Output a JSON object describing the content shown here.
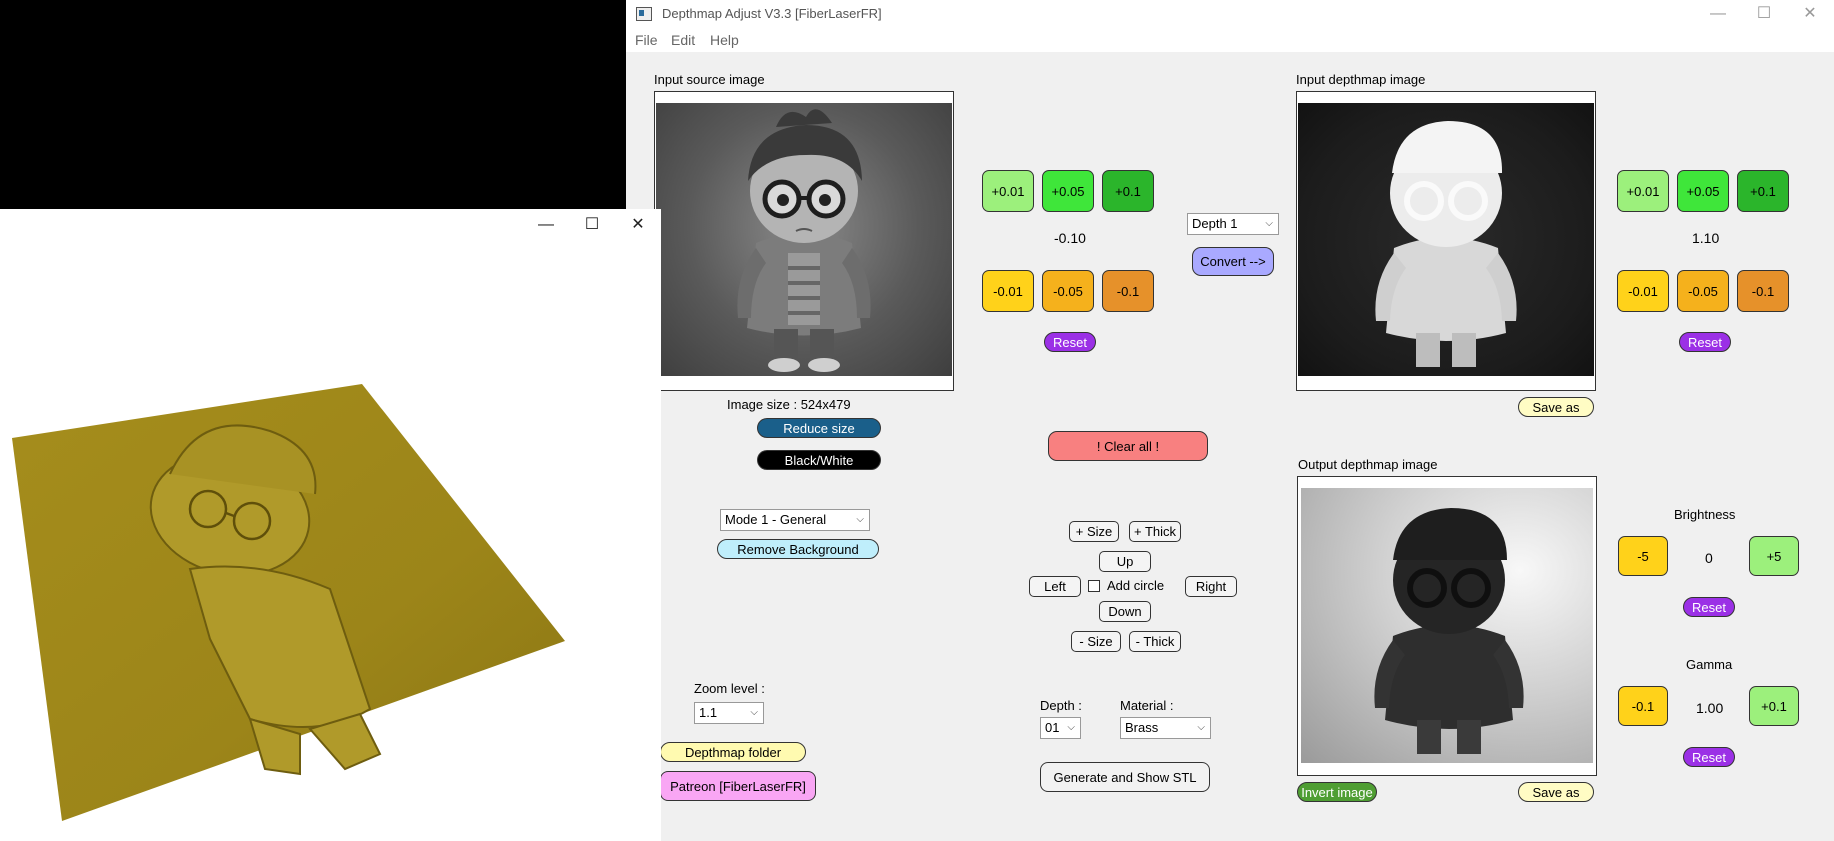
{
  "window": {
    "title": "Depthmap Adjust V3.3 [FiberLaserFR]",
    "minimize_glyph": "—",
    "maximize_glyph": "☐",
    "close_glyph": "✕"
  },
  "menu": [
    "File",
    "Edit",
    "Help"
  ],
  "source": {
    "label": "Input source image",
    "size_text": "Image size : 524x479",
    "reduce_label": "Reduce size",
    "bw_label": "Black/White",
    "mode_value": "Mode 1 - General",
    "remove_bg_label": "Remove Background",
    "zoom_label": "Zoom level :",
    "zoom_value": "1.1",
    "folder_label": "Depthmap folder",
    "patreon_label": "Patreon [FiberLaserFR]"
  },
  "adjust_left": {
    "plus": [
      "+0.01",
      "+0.05",
      "+0.1"
    ],
    "value": "-0.10",
    "minus": [
      "-0.01",
      "-0.05",
      "-0.1"
    ],
    "reset_label": "Reset"
  },
  "convert": {
    "depth_value": "Depth 1",
    "convert_label": "Convert -->"
  },
  "clear_all_label": "!   Clear all   !",
  "circle": {
    "size_plus": "+ Size",
    "thick_plus": "+ Thick",
    "up": "Up",
    "left": "Left",
    "add_circle": "Add circle",
    "right": "Right",
    "down": "Down",
    "size_minus": "- Size",
    "thick_minus": "- Thick"
  },
  "stl": {
    "depth_label": "Depth :",
    "depth_value": "01",
    "material_label": "Material :",
    "material_value": "Brass",
    "generate_label": "Generate and Show STL"
  },
  "input_depth": {
    "label": "Input depthmap image",
    "plus": [
      "+0.01",
      "+0.05",
      "+0.1"
    ],
    "value": "1.10",
    "minus": [
      "-0.01",
      "-0.05",
      "-0.1"
    ],
    "reset_label": "Reset",
    "save_label": "Save as"
  },
  "output_depth": {
    "label": "Output depthmap image",
    "invert_label": "Invert image",
    "save_label": "Save as"
  },
  "brightness": {
    "label": "Brightness",
    "minus": "-5",
    "value": "0",
    "plus": "+5",
    "reset_label": "Reset"
  },
  "gamma": {
    "label": "Gamma",
    "minus": "-0.1",
    "value": "1.00",
    "plus": "+0.1",
    "reset_label": "Reset"
  },
  "viewer": {
    "minimize_glyph": "—",
    "maximize_glyph": "☐",
    "close_glyph": "✕"
  },
  "colors": {
    "clear_all": "#f88080",
    "reduce": "#1a5f8a",
    "remove_bg": "#bfeefb",
    "folder": "#fffab0",
    "patreon": "#f9a6f4",
    "convert": "#a9a9ff",
    "invert": "#4f9e33",
    "save": "#fffcc4",
    "brass": "#9c8519"
  }
}
